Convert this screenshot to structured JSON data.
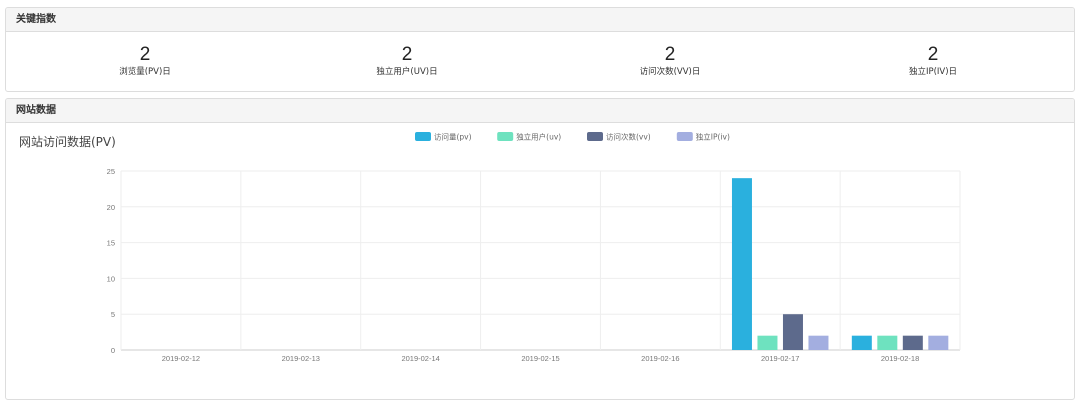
{
  "key_panel": {
    "heading": "关键指数",
    "stats": [
      {
        "value": "2",
        "label": "浏览量(PV)日"
      },
      {
        "value": "2",
        "label": "独立用户(UV)日"
      },
      {
        "value": "2",
        "label": "访问次数(VV)日"
      },
      {
        "value": "2",
        "label": "独立IP(IV)日"
      }
    ]
  },
  "site_panel": {
    "heading": "网站数据"
  },
  "chart_data": {
    "type": "bar",
    "title": "网站访问数据(PV)",
    "xlabel": "",
    "ylabel": "",
    "ylim": [
      0,
      25
    ],
    "yticks": [
      0,
      5,
      10,
      15,
      20,
      25
    ],
    "grid": true,
    "legend_position": "top-center",
    "categories": [
      "2019-02-12",
      "2019-02-13",
      "2019-02-14",
      "2019-02-15",
      "2019-02-16",
      "2019-02-17",
      "2019-02-18"
    ],
    "series": [
      {
        "name": "访问量(pv)",
        "color": "#2ab0de",
        "values": [
          0,
          0,
          0,
          0,
          0,
          24,
          2
        ]
      },
      {
        "name": "独立用户(uv)",
        "color": "#6ee2bf",
        "values": [
          0,
          0,
          0,
          0,
          0,
          2,
          2
        ]
      },
      {
        "name": "访问次数(vv)",
        "color": "#5d6a8c",
        "values": [
          0,
          0,
          0,
          0,
          0,
          5,
          2
        ]
      },
      {
        "name": "独立IP(iv)",
        "color": "#a3aee0",
        "values": [
          0,
          0,
          0,
          0,
          0,
          2,
          2
        ]
      }
    ]
  }
}
